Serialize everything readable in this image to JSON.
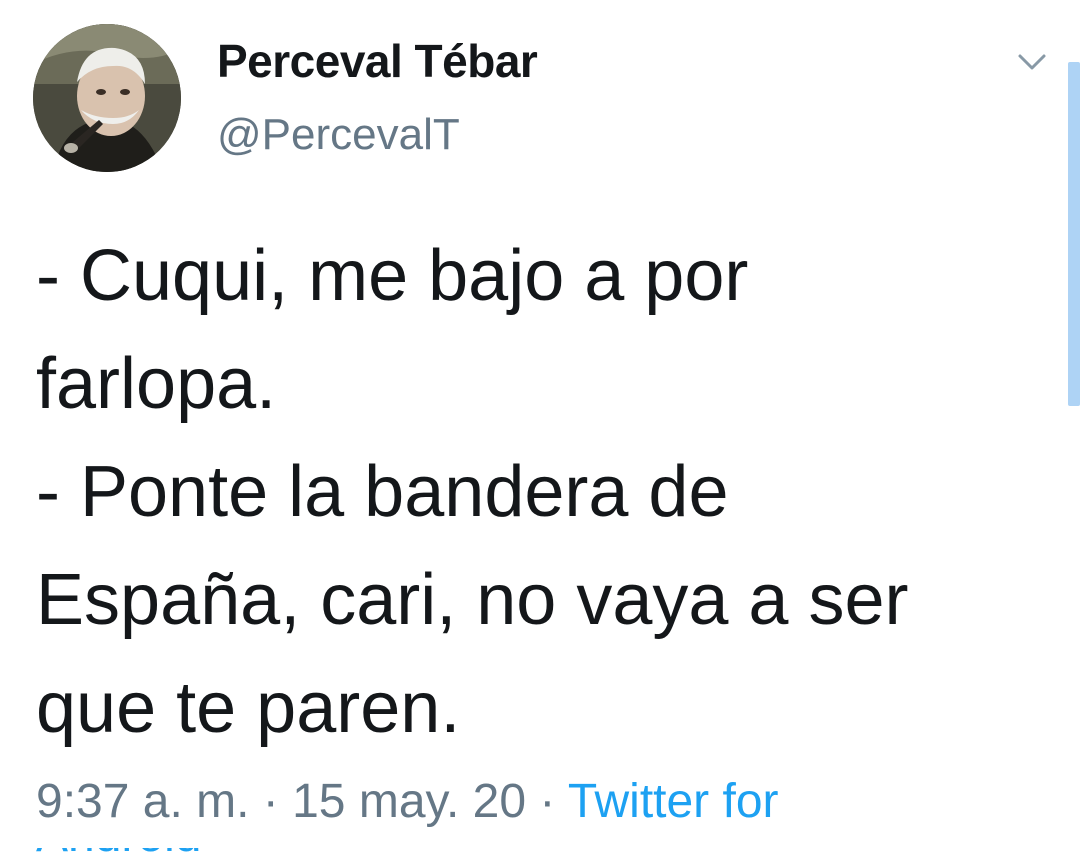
{
  "user": {
    "display_name": "Perceval Tébar",
    "handle": "@PercevalT",
    "avatar_icon": "profile-photo"
  },
  "menu": {
    "icon": "chevron-down-icon"
  },
  "tweet": {
    "lines": [
      "- Cuqui, me bajo a por",
      "farlopa.",
      "- Ponte la bandera de",
      "España, cari, no vaya a ser",
      "que te paren."
    ]
  },
  "meta": {
    "time": "9:37 a. m.",
    "separator": " · ",
    "date": "15 may. 20",
    "source": "Twitter for",
    "source_cut": "Android"
  },
  "colors": {
    "text": "#14171a",
    "secondary": "#657786",
    "link": "#1da1f2",
    "scroll": "#aed3f5"
  }
}
